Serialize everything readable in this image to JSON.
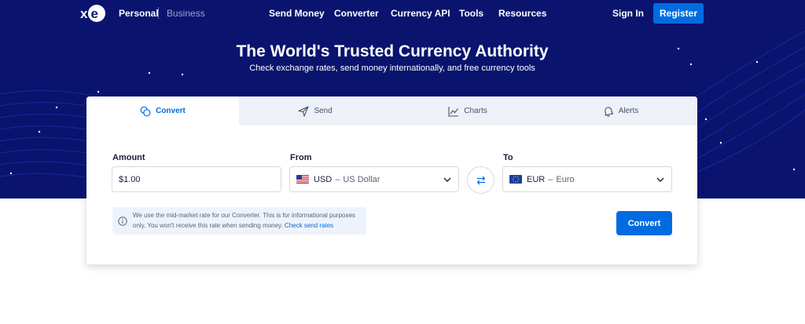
{
  "brand": {
    "logo_text": "xe",
    "accent": "#006ce0",
    "hero_bg": "#0a146e"
  },
  "nav": {
    "personal": "Personal",
    "business": "Business",
    "links": [
      "Send Money",
      "Converter",
      "Currency API",
      "Tools",
      "Resources"
    ],
    "sign_in": "Sign In",
    "register": "Register"
  },
  "hero": {
    "title": "The World's Trusted Currency Authority",
    "subtitle": "Check exchange rates, send money internationally, and free currency tools"
  },
  "tabs": [
    {
      "label": "Convert",
      "icon": "coins-icon",
      "active": true
    },
    {
      "label": "Send",
      "icon": "paper-plane-icon",
      "active": false
    },
    {
      "label": "Charts",
      "icon": "line-chart-icon",
      "active": false
    },
    {
      "label": "Alerts",
      "icon": "bell-icon",
      "active": false
    }
  ],
  "converter": {
    "amount_label": "Amount",
    "amount_value": "$1.00",
    "from_label": "From",
    "from_code": "USD",
    "from_name": "US Dollar",
    "to_label": "To",
    "to_code": "EUR",
    "to_name": "Euro",
    "dash": "–",
    "info_text": "We use the mid-market rate for our Converter. This is for informational purposes only. You won't receive this rate when sending money.",
    "info_link": "Check send rates",
    "convert_button": "Convert"
  }
}
